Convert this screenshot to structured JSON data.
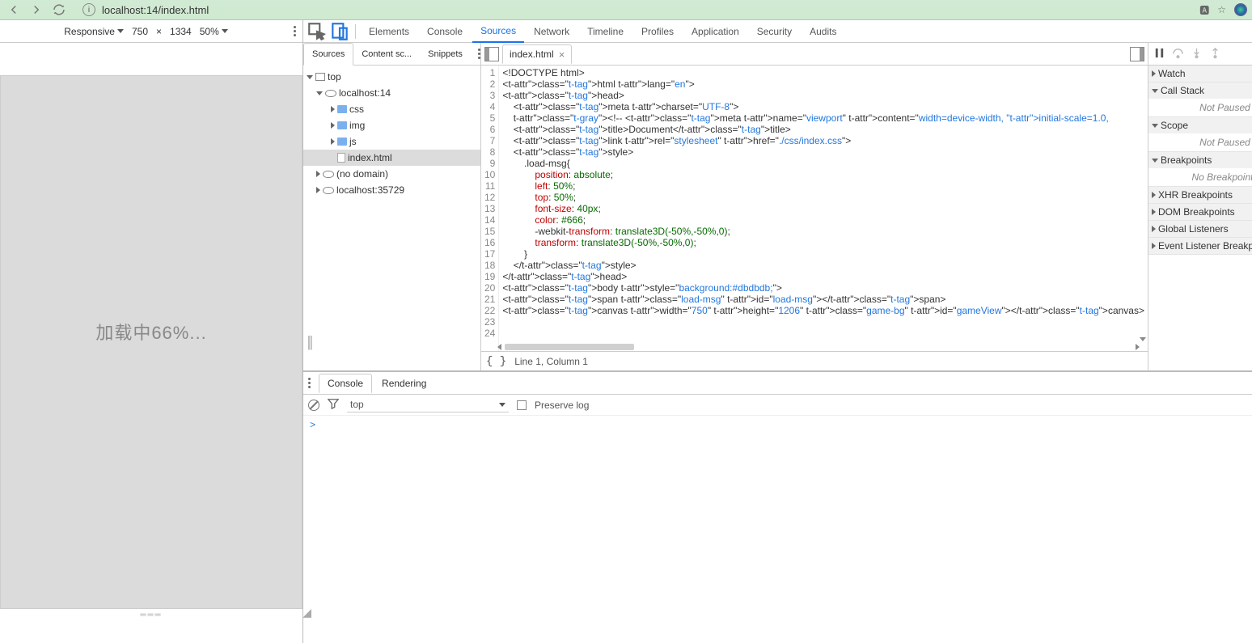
{
  "browser": {
    "url": "localhost:14/index.html"
  },
  "device_toolbar": {
    "mode": "Responsive",
    "width": "750",
    "times": "×",
    "height": "1334",
    "zoom": "50%"
  },
  "preview": {
    "loading_text": "加载中66%..."
  },
  "devtools": {
    "tabs": {
      "elements": "Elements",
      "console": "Console",
      "sources": "Sources",
      "network": "Network",
      "timeline": "Timeline",
      "profiles": "Profiles",
      "application": "Application",
      "security": "Security",
      "audits": "Audits"
    },
    "sources_nav_tabs": {
      "sources": "Sources",
      "content": "Content sc...",
      "snippets": "Snippets"
    },
    "tree": {
      "top": "top",
      "host1": "localhost:14",
      "css": "css",
      "img": "img",
      "js": "js",
      "index": "index.html",
      "nodomain": "(no domain)",
      "host2": "localhost:35729"
    },
    "open_tab": "index.html",
    "status": "Line 1, Column 1",
    "code_lines": [
      "<!DOCTYPE html>",
      "<html lang=\"en\">",
      "<head>",
      "    <meta charset=\"UTF-8\">",
      "    <!-- <meta name=\"viewport\" content=\"width=device-width, initial-scale=1.0,",
      "    <title>Document</title>",
      "    <link rel=\"stylesheet\" href=\"./css/index.css\">",
      "    <style>",
      "        .load-msg{",
      "            position: absolute;",
      "            left:50%;",
      "            top:50%;",
      "            font-size:40px;",
      "            color:#666;",
      "            -webkit-transform: translate3D(-50%,-50%,0);",
      "            transform: translate3D(-50%,-50%,0);",
      "        }",
      "    </style>",
      "</head>",
      "<body style=\"background:#dbdbdb;\">",
      "<span class=\"load-msg\" id=\"load-msg\"></span>",
      "<canvas width=\"750\" height=\"1206\" class=\"game-bg\" id=\"gameView\"></canvas>",
      "",
      ""
    ],
    "debug": {
      "watch": "Watch",
      "callstack": "Call Stack",
      "not_paused": "Not Paused",
      "scope": "Scope",
      "breakpoints": "Breakpoints",
      "no_breakpoints": "No Breakpoints",
      "xhr": "XHR Breakpoints",
      "dom": "DOM Breakpoints",
      "global": "Global Listeners",
      "event": "Event Listener Breakpoints"
    }
  },
  "drawer": {
    "tabs": {
      "console": "Console",
      "rendering": "Rendering"
    },
    "context": "top",
    "preserve": "Preserve log",
    "prompt": ">"
  }
}
